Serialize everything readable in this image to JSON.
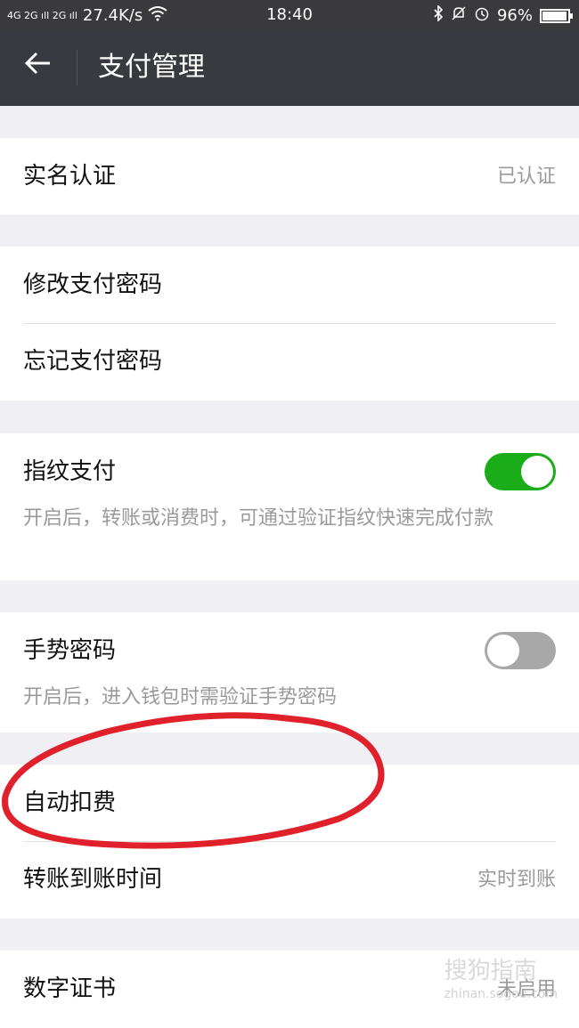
{
  "statusbar": {
    "network": "4G 2G ıll 2G ıll",
    "speed": "27.4K/s",
    "time": "18:40",
    "battery_pct": "96%",
    "battery_level": 0.96,
    "icons": [
      "wifi-icon",
      "bluetooth-icon",
      "mute-icon",
      "alarm-icon",
      "battery-icon"
    ]
  },
  "header": {
    "back_icon": "arrow-left-icon",
    "title": "支付管理"
  },
  "items": {
    "realname": {
      "label": "实名认证",
      "value": "已认证"
    },
    "change_pwd": {
      "label": "修改支付密码"
    },
    "forgot_pwd": {
      "label": "忘记支付密码"
    },
    "fingerprint": {
      "label": "指纹支付",
      "enabled": true,
      "desc": "开启后，转账或消费时，可通过验证指纹快速完成付款"
    },
    "gesture": {
      "label": "手势密码",
      "enabled": false,
      "desc": "开启后，进入钱包时需验证手势密码"
    },
    "auto_deduct": {
      "label": "自动扣费"
    },
    "transfer_time": {
      "label": "转账到账时间",
      "value": "实时到账"
    },
    "certificate": {
      "label": "数字证书",
      "value": "未启用"
    }
  },
  "annotation": {
    "color": "#e0202a"
  },
  "watermark": {
    "text": "搜狗指南",
    "sub": "zhinan.sogou.com"
  },
  "colors": {
    "accent": "#1aad19",
    "header": "#393a3f",
    "background": "#efeff4"
  }
}
